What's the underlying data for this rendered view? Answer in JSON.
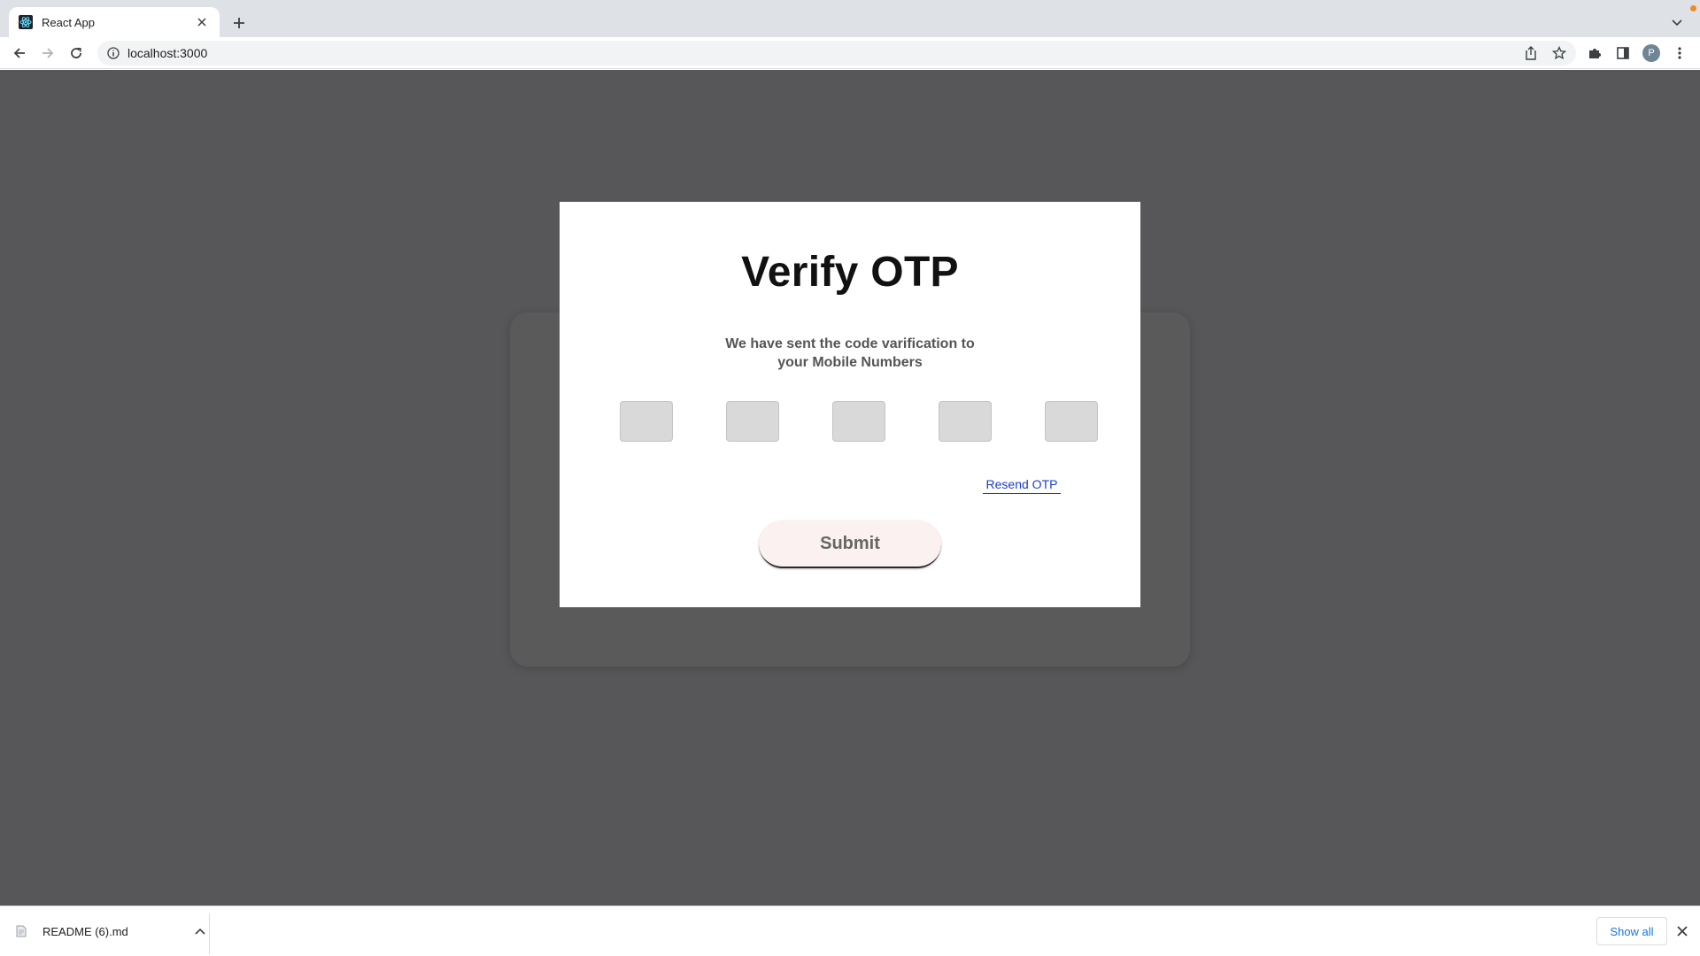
{
  "browser": {
    "tab": {
      "title": "React App",
      "favicon": "react-icon"
    },
    "url": "localhost:3000",
    "profile_initial": "P"
  },
  "modal": {
    "title": "Verify OTP",
    "subtitle_line1": "We have sent the code varification to",
    "subtitle_line2": "your Mobile Numbers",
    "otp_fields": [
      "",
      "",
      "",
      "",
      ""
    ],
    "resend_label": "Resend OTP",
    "submit_label": "Submit"
  },
  "downloads": {
    "file_name": "README (6).md",
    "show_all_label": "Show all"
  },
  "colors": {
    "page_bg": "#575759",
    "modal_bg": "#ffffff",
    "otp_box": "#d9d9d9",
    "link": "#1a3ccf",
    "submit_bg": "#faf1f0"
  }
}
